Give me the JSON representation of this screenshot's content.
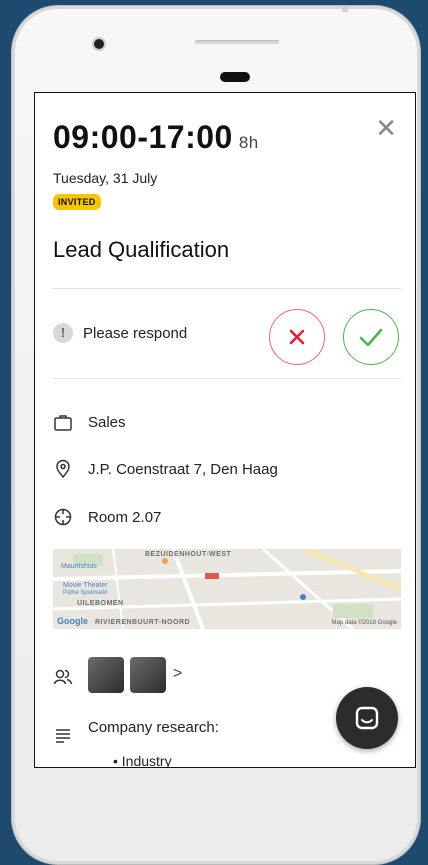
{
  "event": {
    "time_range": "09:00-17:00",
    "duration": "8h",
    "date": "Tuesday, 31 July",
    "status_badge": "INVITED",
    "title": "Lead Qualification"
  },
  "rsvp": {
    "prompt": "Please respond",
    "prompt_icon": "!",
    "decline_icon": "close-icon",
    "accept_icon": "checkmark-icon"
  },
  "details": {
    "category": "Sales",
    "address": "J.P. Coenstraat 7, Den Haag",
    "room": "Room 2.07"
  },
  "map": {
    "district_top": "BEZUIDENHOUT-WEST",
    "district_mid": "UILEBOMEN",
    "district_bottom": "RIVIERENBUURT-NOORD",
    "place_1": "Mauritshuis",
    "place_2": "Movie Theater",
    "place_3": "Pathé Spuimarkt",
    "google": "Google",
    "credit": "Map data ©2018 Google"
  },
  "attendees": {
    "chevron": ">"
  },
  "notes": {
    "label": "Company research:",
    "bullet": "Industry"
  },
  "colors": {
    "badge": "#f7c600",
    "decline": "#e36a73",
    "accept": "#48b84e",
    "background": "#1d4a6e"
  }
}
